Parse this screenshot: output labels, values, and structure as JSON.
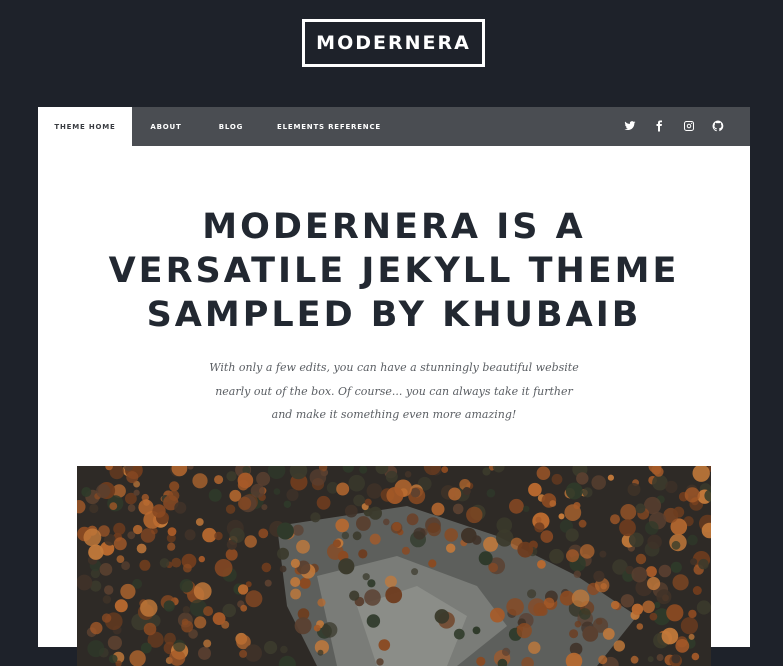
{
  "site": {
    "logo": "MODERNERA"
  },
  "nav": {
    "items": [
      {
        "label": "THEME HOME",
        "active": true
      },
      {
        "label": "ABOUT",
        "active": false
      },
      {
        "label": "BLOG",
        "active": false
      },
      {
        "label": "ELEMENTS REFERENCE",
        "active": false
      }
    ],
    "social": [
      "twitter-icon",
      "facebook-icon",
      "instagram-icon",
      "github-icon"
    ]
  },
  "main": {
    "headline": "MODERNERA IS A VERSATILE JEKYLL THEME SAMPLED BY KHUBAIB",
    "intro_lines": [
      "With only a few edits, you can have a stunningly beautiful website",
      "nearly out of the box. Of course... you can always take it further",
      "and make it something even more amazing!"
    ],
    "hero_image": "autumn forest cliff photo"
  },
  "colors": {
    "background": "#1e222a",
    "nav": "#4a4d52",
    "text": "#222831"
  }
}
